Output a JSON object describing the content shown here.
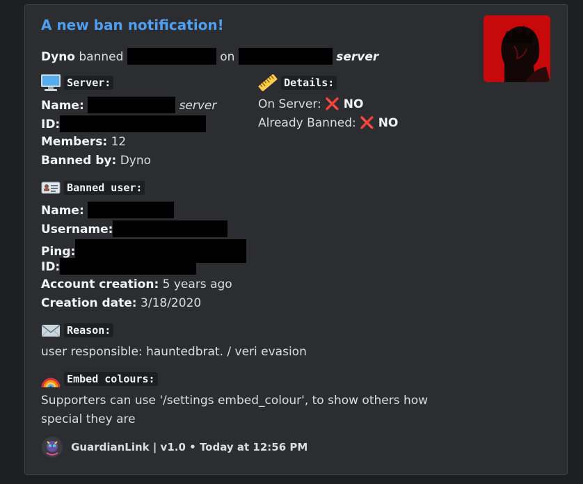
{
  "embed": {
    "title": "A new ban notification!",
    "intro": {
      "actor": "Dyno",
      "verb": "banned",
      "on": "on",
      "server_suffix": "server"
    },
    "server_section": {
      "heading": "Server:",
      "name_label": "Name:",
      "name_suffix": "server",
      "id_label": "ID:",
      "members_label": "Members:",
      "members_value": "12",
      "banned_by_label": "Banned by:",
      "banned_by_value": "Dyno"
    },
    "details_section": {
      "heading": "Details:",
      "on_server_label": "On Server:",
      "on_server_icon": "❌",
      "on_server_value": "NO",
      "already_banned_label": "Already Banned:",
      "already_banned_icon": "❌",
      "already_banned_value": "NO"
    },
    "banned_user_section": {
      "heading": "Banned user:",
      "name_label": "Name:",
      "username_label": "Username:",
      "ping_label": "Ping:",
      "id_label": "ID:",
      "account_creation_label": "Account creation:",
      "account_creation_value": "5 years ago",
      "creation_date_label": "Creation date:",
      "creation_date_value": "3/18/2020"
    },
    "reason_section": {
      "heading": "Reason:",
      "text": "user responsible: hauntedbrat. / veri evasion"
    },
    "embed_colours_section": {
      "heading": "Embed colours:",
      "line1": "Supporters can use '/settings embed_colour', to show others how",
      "line2": "special they are"
    },
    "footer": {
      "text": "GuardianLink | v1.0 • Today at 12:56 PM"
    }
  },
  "colors": {
    "background": "#1e1f22",
    "embed_bg": "#2b2d31",
    "title": "#4e9ff0",
    "thumbnail_bg": "#c8090c"
  },
  "icons": {
    "server": "desktop-computer-icon",
    "details": "ruler-icon",
    "banned_user": "id-card-icon",
    "reason": "envelope-icon",
    "embed_colours": "rainbow-icon",
    "no": "cross-mark-icon"
  }
}
